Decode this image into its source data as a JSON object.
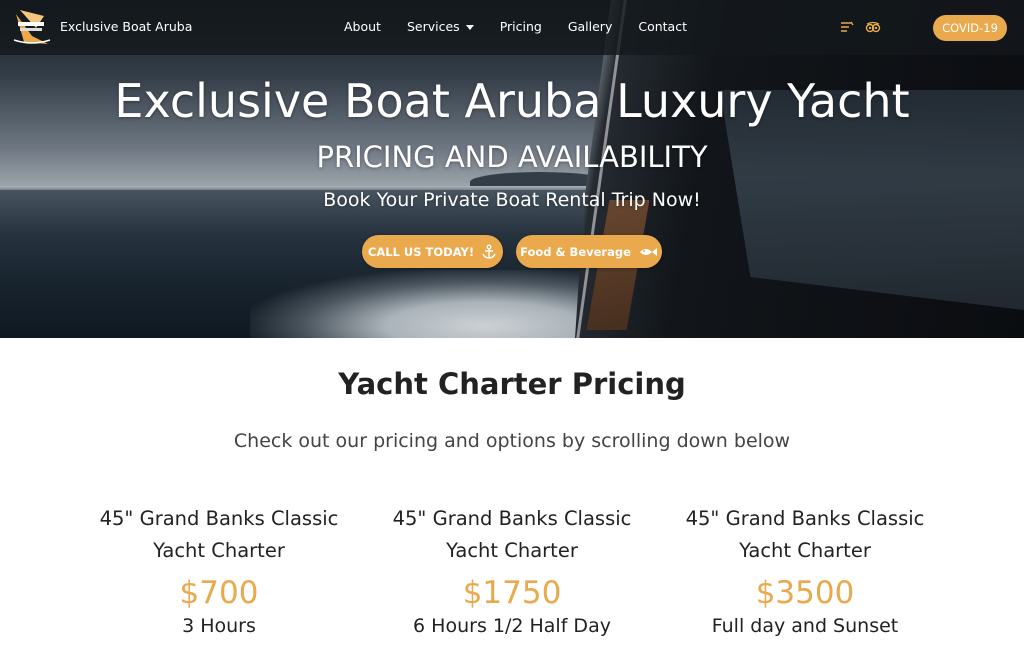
{
  "brand": {
    "name": "Exclusive Boat Aruba"
  },
  "nav": {
    "items": [
      {
        "label": "About"
      },
      {
        "label": "Services"
      },
      {
        "label": "Pricing"
      },
      {
        "label": "Gallery"
      },
      {
        "label": "Contact"
      }
    ],
    "social": [
      "facebook-icon",
      "tripadvisor-icon"
    ],
    "covid_label": "COVID-19"
  },
  "hero": {
    "title": "Exclusive Boat Aruba Luxury Yacht",
    "subtitle": "PRICING AND AVAILABILITY",
    "tagline": "Book Your Private Boat Rental Trip Now!",
    "cta_call": "CALL US TODAY!",
    "cta_food": "Food & Beverage"
  },
  "pricing": {
    "title": "Yacht Charter Pricing",
    "subtitle": "Check out our pricing and options by scrolling down below",
    "plans": [
      {
        "name_line1": "45\" Grand Banks Classic",
        "name_line2": "Yacht Charter",
        "price": "$700",
        "duration": "3 Hours"
      },
      {
        "name_line1": "45\" Grand Banks Classic",
        "name_line2": "Yacht Charter",
        "price": "$1750",
        "duration": "6 Hours 1/2 Half Day"
      },
      {
        "name_line1": "45\" Grand Banks Classic",
        "name_line2": "Yacht Charter",
        "price": "$3500",
        "duration": "Full day and Sunset"
      }
    ]
  },
  "colors": {
    "accent": "#e9a94c",
    "nav_bg": "#14181c"
  }
}
